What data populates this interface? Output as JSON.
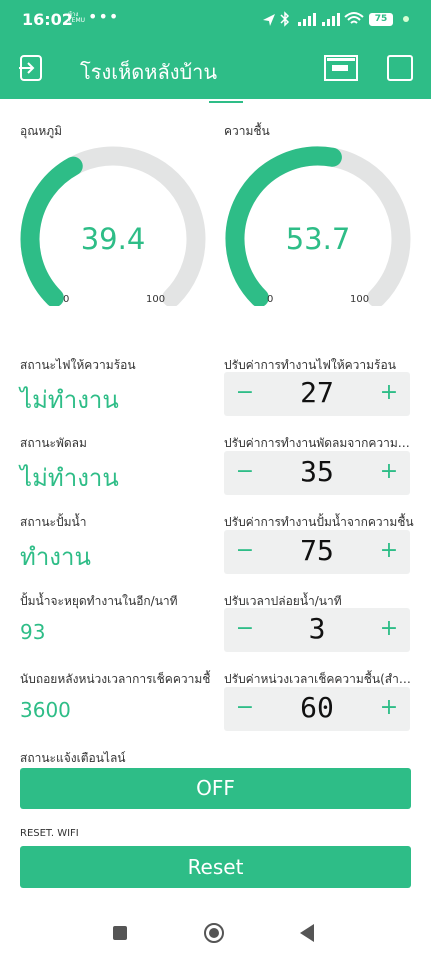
{
  "status_bar": {
    "time": "16:02",
    "small_text_line1": "ห้าง",
    "small_text_line2": "TEMU",
    "dots": "•••",
    "battery": "75"
  },
  "app": {
    "title": "โรงเห็ดหลังบ้าน"
  },
  "gauges": [
    {
      "label": "อุณหภูมิ",
      "value": "39.4",
      "min": "0",
      "max": "100",
      "fraction": 0.394
    },
    {
      "label": "ความชื้น",
      "value": "53.7",
      "min": "0",
      "max": "100",
      "fraction": 0.537
    }
  ],
  "status_rows": [
    {
      "label": "สถานะไฟให้ความร้อน",
      "value": "ไม่ทำงาน"
    },
    {
      "label": "สถานะพัดลม",
      "value": "ไม่ทำงาน"
    },
    {
      "label": "สถานะปั้มน้ำ",
      "value": "ทำงาน"
    },
    {
      "label": "ปั้มน้ำจะหยุดทำงานในอีก/นาที",
      "value": "93"
    },
    {
      "label": "นับถอยหลังหน่วงเวลาการเช็คความชื้",
      "value": "3600"
    }
  ],
  "steppers": [
    {
      "label": "ปรับค่าการทำงานไฟให้ความร้อน",
      "value": "27",
      "minus": "−",
      "plus": "+"
    },
    {
      "label": "ปรับค่าการทำงานพัดลมจากความร้...",
      "value": "35",
      "minus": "−",
      "plus": "+"
    },
    {
      "label": "ปรับค่าการทำงานปั้มน้ำจากความชื้น",
      "value": "75",
      "minus": "−",
      "plus": "+"
    },
    {
      "label": "ปรับเวลาปล่อยน้ำ/นาที",
      "value": "3",
      "minus": "−",
      "plus": "+"
    },
    {
      "label": "ปรับค่าหน่วงเวลาเช็คความชื้น(สำห...",
      "value": "60",
      "minus": "−",
      "plus": "+"
    }
  ],
  "line_alert": {
    "label": "สถานะแจ้งเตือนไลน์",
    "button": "OFF"
  },
  "reset_wifi": {
    "label": "RESET. WIFI",
    "button": "Reset"
  },
  "colors": {
    "accent": "#2ebd87",
    "track": "#e3e4e4",
    "stepper_bg": "#eff0f0"
  }
}
